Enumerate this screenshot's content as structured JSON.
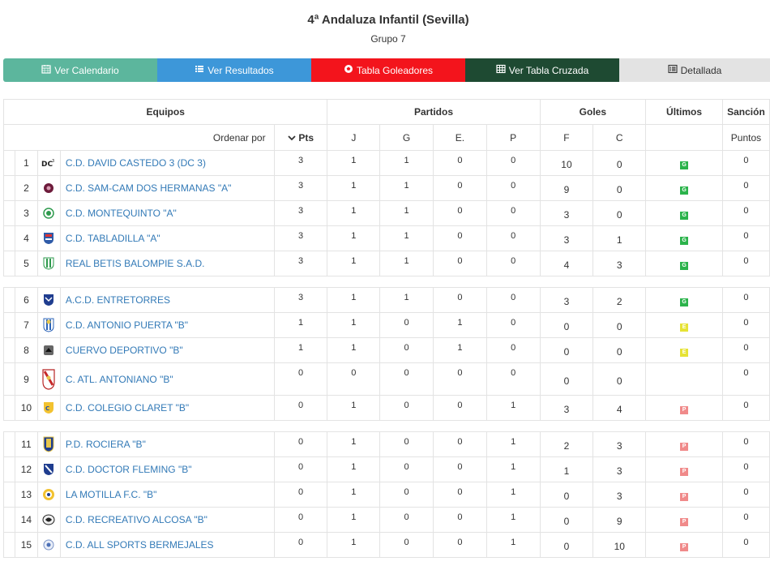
{
  "header": {
    "title": "4ª Andaluza Infantil (Sevilla)",
    "subtitle": "Grupo 7"
  },
  "tabs": [
    {
      "label": "Ver Calendario",
      "icon": "calendar-icon"
    },
    {
      "label": "Ver Resultados",
      "icon": "list-icon"
    },
    {
      "label": "Tabla Goleadores",
      "icon": "soccer-ball-icon"
    },
    {
      "label": "Ver Tabla Cruzada",
      "icon": "table-icon"
    },
    {
      "label": "Detallada",
      "icon": "list-alt-icon"
    }
  ],
  "table": {
    "group_headers": {
      "equipos": "Equipos",
      "partidos": "Partidos",
      "goles": "Goles",
      "ultimos": "Últimos",
      "sancion": "Sanción"
    },
    "sub_headers": {
      "ordenar": "Ordenar por",
      "pts": "Pts",
      "j": "J",
      "g": "G",
      "e": "E.",
      "p": "P",
      "f": "F",
      "c": "C",
      "puntos": "Puntos"
    },
    "rows": [
      {
        "pos": "1",
        "team": "C.D. DAVID CASTEDO 3 (DC 3)",
        "pts": "3",
        "j": "1",
        "g": "1",
        "e": "0",
        "p": "0",
        "f": "10",
        "c": "0",
        "last": "G",
        "sancion": "0",
        "crest": "dc3"
      },
      {
        "pos": "2",
        "team": "C.D. SAM-CAM DOS HERMANAS \"A\"",
        "pts": "3",
        "j": "1",
        "g": "1",
        "e": "0",
        "p": "0",
        "f": "9",
        "c": "0",
        "last": "G",
        "sancion": "0",
        "crest": "samcam"
      },
      {
        "pos": "3",
        "team": "C.D. MONTEQUINTO \"A\"",
        "pts": "3",
        "j": "1",
        "g": "1",
        "e": "0",
        "p": "0",
        "f": "3",
        "c": "0",
        "last": "G",
        "sancion": "0",
        "crest": "montequinto"
      },
      {
        "pos": "4",
        "team": "C.D. TABLADILLA \"A\"",
        "pts": "3",
        "j": "1",
        "g": "1",
        "e": "0",
        "p": "0",
        "f": "3",
        "c": "1",
        "last": "G",
        "sancion": "0",
        "crest": "tabladilla"
      },
      {
        "pos": "5",
        "team": "REAL BETIS BALOMPIE S.A.D.",
        "pts": "3",
        "j": "1",
        "g": "1",
        "e": "0",
        "p": "0",
        "f": "4",
        "c": "3",
        "last": "G",
        "sancion": "0",
        "crest": "betis"
      },
      {
        "pos": "6",
        "team": "A.C.D. ENTRETORRES",
        "pts": "3",
        "j": "1",
        "g": "1",
        "e": "0",
        "p": "0",
        "f": "3",
        "c": "2",
        "last": "G",
        "sancion": "0",
        "crest": "entretorres"
      },
      {
        "pos": "7",
        "team": "C.D. ANTONIO PUERTA \"B\"",
        "pts": "1",
        "j": "1",
        "g": "0",
        "e": "1",
        "p": "0",
        "f": "0",
        "c": "0",
        "last": "E",
        "sancion": "0",
        "crest": "puerta"
      },
      {
        "pos": "8",
        "team": "CUERVO DEPORTIVO \"B\"",
        "pts": "1",
        "j": "1",
        "g": "0",
        "e": "1",
        "p": "0",
        "f": "0",
        "c": "0",
        "last": "E",
        "sancion": "0",
        "crest": "cuervo"
      },
      {
        "pos": "9",
        "team": "C. ATL. ANTONIANO \"B\"",
        "pts": "0",
        "j": "0",
        "g": "0",
        "e": "0",
        "p": "0",
        "f": "0",
        "c": "0",
        "last": "",
        "sancion": "0",
        "crest": "antoniano"
      },
      {
        "pos": "10",
        "team": "C.D. COLEGIO CLARET \"B\"",
        "pts": "0",
        "j": "1",
        "g": "0",
        "e": "0",
        "p": "1",
        "f": "3",
        "c": "4",
        "last": "P",
        "sancion": "0",
        "crest": "claret"
      },
      {
        "pos": "11",
        "team": "P.D. ROCIERA \"B\"",
        "pts": "0",
        "j": "1",
        "g": "0",
        "e": "0",
        "p": "1",
        "f": "2",
        "c": "3",
        "last": "P",
        "sancion": "0",
        "crest": "rociera"
      },
      {
        "pos": "12",
        "team": "C.D. DOCTOR FLEMING \"B\"",
        "pts": "0",
        "j": "1",
        "g": "0",
        "e": "0",
        "p": "1",
        "f": "1",
        "c": "3",
        "last": "P",
        "sancion": "0",
        "crest": "fleming"
      },
      {
        "pos": "13",
        "team": "LA MOTILLA F.C. \"B\"",
        "pts": "0",
        "j": "1",
        "g": "0",
        "e": "0",
        "p": "1",
        "f": "0",
        "c": "3",
        "last": "P",
        "sancion": "0",
        "crest": "motilla"
      },
      {
        "pos": "14",
        "team": "C.D. RECREATIVO ALCOSA \"B\"",
        "pts": "0",
        "j": "1",
        "g": "0",
        "e": "0",
        "p": "1",
        "f": "0",
        "c": "9",
        "last": "P",
        "sancion": "0",
        "crest": "alcosa"
      },
      {
        "pos": "15",
        "team": "C.D. ALL SPORTS BERMEJALES",
        "pts": "0",
        "j": "1",
        "g": "0",
        "e": "0",
        "p": "1",
        "f": "0",
        "c": "10",
        "last": "P",
        "sancion": "0",
        "crest": "allsports"
      }
    ],
    "separators_after": [
      5,
      10
    ]
  },
  "colors": {
    "calendario": "#5cb69d",
    "resultados": "#3d97d9",
    "goleadores": "#f3141c",
    "cruzada": "#1e4a32",
    "detallada": "#e3e3e3",
    "link": "#337ab7",
    "win": "#2bb34b",
    "draw": "#e6e335",
    "loss": "#f08a8a"
  }
}
